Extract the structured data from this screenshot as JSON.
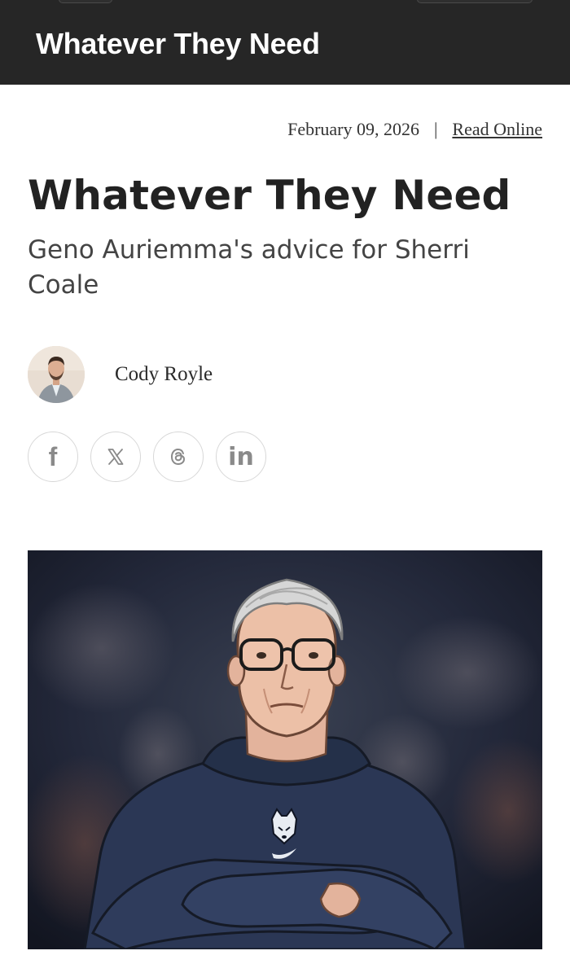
{
  "header": {
    "brand": "Whatever They Need",
    "background_color": "#262626"
  },
  "meta": {
    "date": "February 09, 2026",
    "separator": "|",
    "read_online": "Read Online"
  },
  "article": {
    "title": "Whatever They Need",
    "subtitle": "Geno Auriemma's advice for Sherri Coale",
    "author": "Cody Royle"
  },
  "share": [
    {
      "name": "facebook",
      "icon": "facebook-icon",
      "glyph": "f"
    },
    {
      "name": "x",
      "icon": "x-icon",
      "glyph": "𝕏"
    },
    {
      "name": "threads",
      "icon": "threads-icon",
      "glyph": "@"
    },
    {
      "name": "linkedin",
      "icon": "linkedin-icon",
      "glyph": "in"
    }
  ],
  "hero": {
    "icon": "hero-illustration",
    "accent_navy": "#2b3755"
  }
}
